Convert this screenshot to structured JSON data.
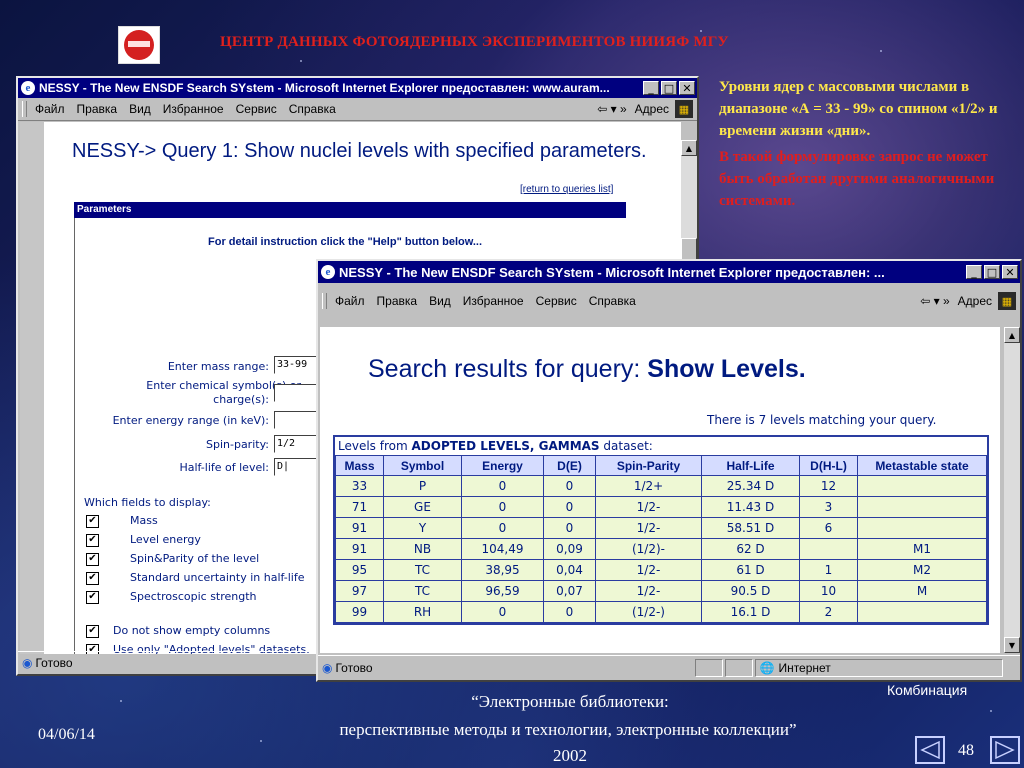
{
  "slide": {
    "header_title": "ЦЕНТР ДАННЫХ ФОТОЯДЕРНЫХ ЭКСПЕРИМЕНТОВ НИИЯФ МГУ",
    "description": "Уровни ядер с массовыми числами в диапазоне «А = 33 - 99» со спином «1/2» и времени жизни «дни».",
    "note": "В такой формулировке запрос не может  быть обработан другими аналогичными системами.",
    "footer_line1": "“Электронные библиотеки:",
    "footer_line2": "перспективные методы и технологии, электронные коллекции”",
    "footer_year": "2002",
    "date": "04/06/14",
    "page_number": "48",
    "combination_label": "Комбинация",
    "colors": {
      "header": "#e0201c",
      "description": "#ffe84a",
      "note": "#e01e1e",
      "titlebar": "#00007f"
    }
  },
  "window1": {
    "title": "NESSY - The New ENSDF Search SYstem - Microsoft Internet Explorer предоставлен: www.auram...",
    "menu": [
      "Файл",
      "Правка",
      "Вид",
      "Избранное",
      "Сервис",
      "Справка"
    ],
    "address_label": "Адрес",
    "query_title": "NESSY-> Query 1: Show nuclei levels with specified parameters.",
    "return_link": "[return to queries list]",
    "params_header": "Parameters",
    "instruction": "For detail instruction click the \"Help\" button below...",
    "fields": {
      "mass_label": "Enter mass range:",
      "mass_value": "33-99",
      "chem_label1": "Enter chemical symbol(s) or",
      "chem_label2": "charge(s):",
      "chem_value": "",
      "energy_label": "Enter energy range (in keV):",
      "energy_value": "",
      "spin_label": "Spin-parity:",
      "spin_value": "1/2",
      "halflife_label": "Half-life of level:",
      "halflife_value": "D|"
    },
    "display_label": "Which fields to display:",
    "display_fields": [
      "Mass",
      "Level energy",
      "Spin&Parity of the level",
      "Standard uncertainty in half-life",
      "Spectroscopic strength"
    ],
    "option1": "Do not show empty columns",
    "option2": "Use only \"Adopted levels\" datasets.",
    "checkmark": "✔",
    "status_text": "Готово"
  },
  "window2": {
    "title": "NESSY - The New ENSDF Search SYstem - Microsoft Internet Explorer предоставлен: ...",
    "menu": [
      "Файл",
      "Правка",
      "Вид",
      "Избранное",
      "Сервис",
      "Справка"
    ],
    "address_label": "Адрес",
    "results_prefix": "Search results for query:",
    "results_query": "Show Levels.",
    "count_text": "There is 7 levels matching your query.",
    "dataset_prefix": "Levels from",
    "dataset_name": "ADOPTED LEVELS, GAMMAS",
    "dataset_suffix": "dataset:",
    "columns": [
      "Mass",
      "Symbol",
      "Energy",
      "D(E)",
      "Spin-Parity",
      "Half-Life",
      "D(H-L)",
      "Metastable state"
    ],
    "rows": [
      [
        "33",
        "P",
        "0",
        "0",
        "1/2+",
        "25.34 D",
        "12",
        ""
      ],
      [
        "71",
        "GE",
        "0",
        "0",
        "1/2-",
        "11.43 D",
        "3",
        ""
      ],
      [
        "91",
        "Y",
        "0",
        "0",
        "1/2-",
        "58.51 D",
        "6",
        ""
      ],
      [
        "91",
        "NB",
        "104,49",
        "0,09",
        "(1/2)-",
        "62 D",
        "",
        "M1"
      ],
      [
        "95",
        "TC",
        "38,95",
        "0,04",
        "1/2-",
        "61 D",
        "1",
        "M2"
      ],
      [
        "97",
        "TC",
        "96,59",
        "0,07",
        "1/2-",
        "90.5 D",
        "10",
        "M"
      ],
      [
        "99",
        "RH",
        "0",
        "0",
        "(1/2-)",
        "16.1 D",
        "2",
        ""
      ]
    ],
    "status_text": "Готово",
    "zone_text": "Интернет"
  }
}
